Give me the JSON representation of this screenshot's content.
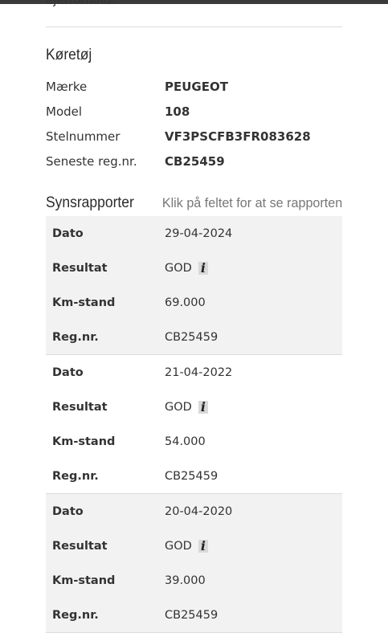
{
  "top_cut_text": "ejerforhold.",
  "vehicle_section": {
    "title": "Køretøj",
    "rows": [
      {
        "label": "Mærke",
        "value": "PEUGEOT"
      },
      {
        "label": "Model",
        "value": "108"
      },
      {
        "label": "Stelnummer",
        "value": "VF3PSCFB3FR083628"
      },
      {
        "label": "Seneste reg.nr.",
        "value": "CB25459"
      }
    ]
  },
  "reports_section": {
    "title": "Synsrapporter",
    "hint": "Klik på feltet for at se rapporten",
    "labels": {
      "date": "Dato",
      "result": "Resultat",
      "km": "Km-stand",
      "reg": "Reg.nr."
    },
    "info_icon": "info-icon",
    "reports": [
      {
        "date": "29-04-2024",
        "result": "GOD",
        "km": "69.000",
        "reg": "CB25459"
      },
      {
        "date": "21-04-2022",
        "result": "GOD",
        "km": "54.000",
        "reg": "CB25459"
      },
      {
        "date": "20-04-2020",
        "result": "GOD",
        "km": "39.000",
        "reg": "CB25459"
      }
    ]
  }
}
